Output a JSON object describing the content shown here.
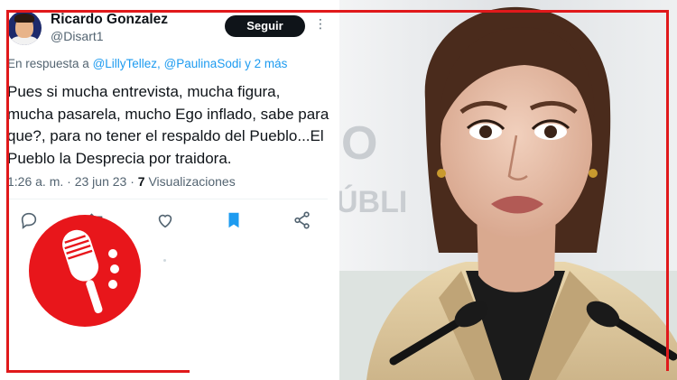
{
  "tweet": {
    "author_name": "Ricardo Gonzalez",
    "author_handle": "@Disart1",
    "follow_label": "Seguir",
    "more_glyph": "⋮",
    "reply_prefix": "En respuesta a",
    "reply_mention_1": "@LillyTellez,",
    "reply_mention_2": "@PaulinaSodi",
    "reply_suffix": "y 2 más",
    "text": "Pues si mucha entrevista, mucha figura, mucha pasarela, mucho Ego inflado, sabe para que?, para no tener el respaldo del Pueblo...El Pueblo la Desprecia por traidora.",
    "time": "1:26 a. m.",
    "separator": "·",
    "date": "23 jun 23",
    "views_count": "7",
    "views_label": "Visualizaciones",
    "actions": [
      {
        "name": "reply-icon"
      },
      {
        "name": "retweet-icon"
      },
      {
        "name": "like-icon"
      },
      {
        "name": "bookmark-icon"
      },
      {
        "name": "share-icon"
      }
    ]
  },
  "colors": {
    "accent_blue": "#1d9bf0",
    "text_primary": "#0f1419",
    "text_secondary": "#536471",
    "frame_red": "#e0191b",
    "logo_red": "#e8161b"
  },
  "photo": {
    "backdrop_letters_1": "O",
    "backdrop_letters_2": "ÚBLI"
  }
}
